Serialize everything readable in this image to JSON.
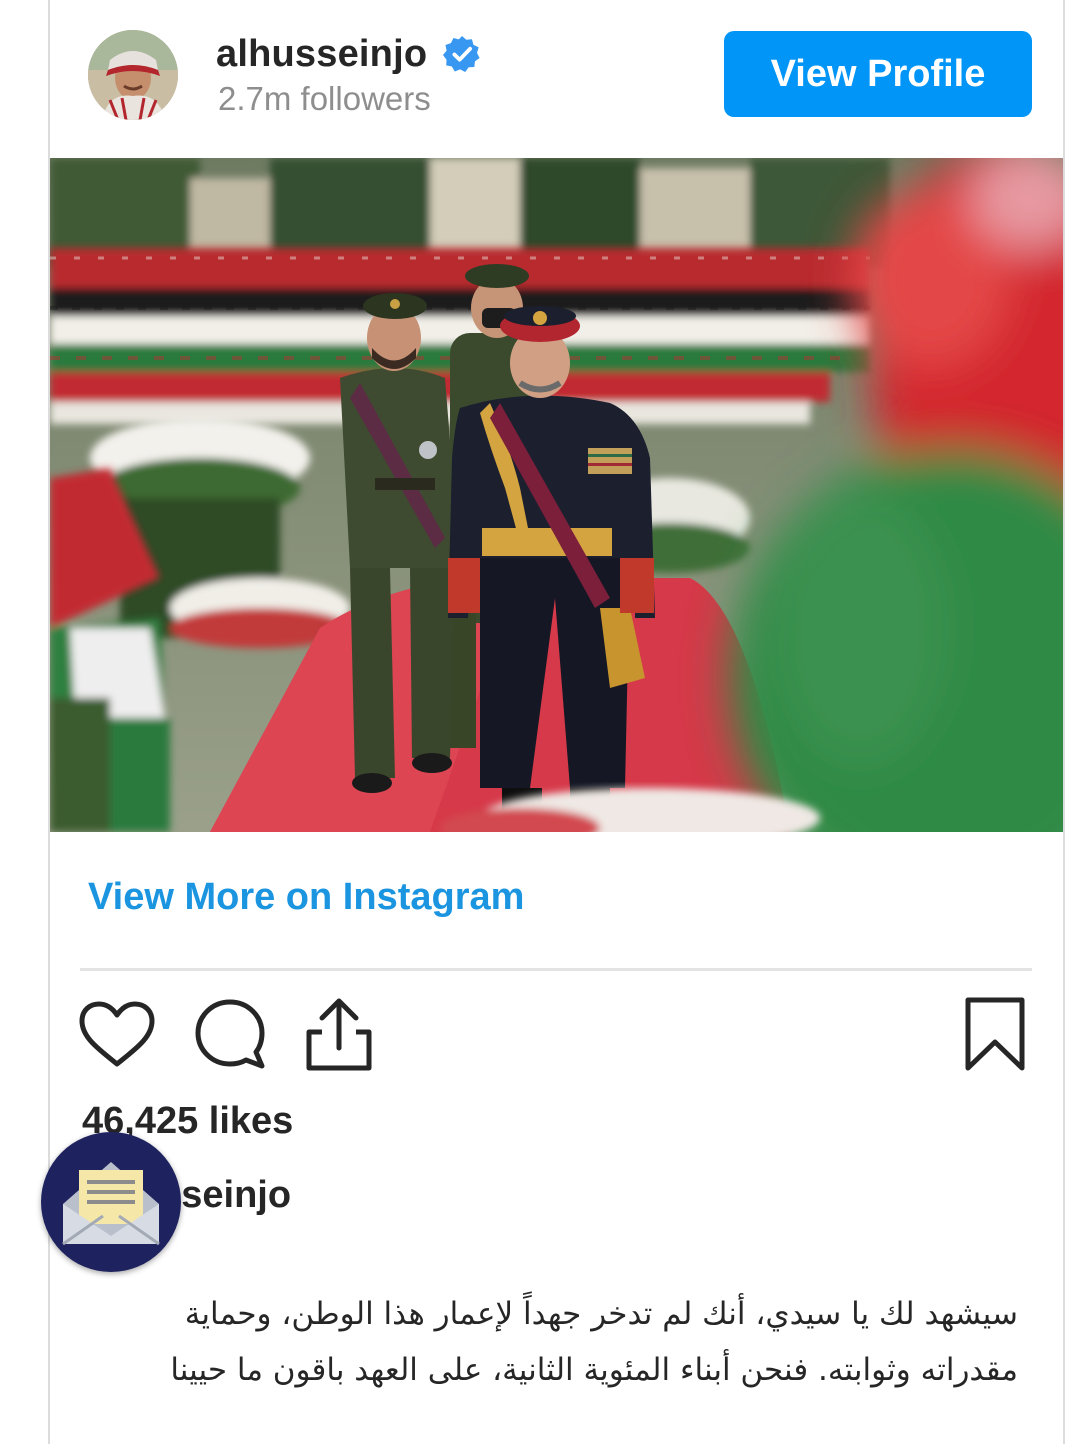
{
  "header": {
    "username": "alhusseinjo",
    "followers": "2.7m followers",
    "view_profile_label": "View Profile"
  },
  "post": {
    "view_more_label": "View More on Instagram",
    "likes": "46,425 likes",
    "caption_user": "alhusseinjo",
    "caption_text": "سيشهد لك يا سيدي، أنك لم تدخر جهداً لإعمار هذا الوطن، وحماية مقدراته وثوابته. فنحن أبناء المئوية الثانية، على العهد باقون ما حيينا"
  },
  "icons": {
    "verified": "verified-badge-icon",
    "like": "heart-icon",
    "comment": "comment-icon",
    "share": "share-icon",
    "save": "bookmark-icon",
    "mail": "envelope-icon"
  },
  "colors": {
    "accent": "#0095f6",
    "link": "#1b95e0",
    "fab": "#1e2360"
  }
}
